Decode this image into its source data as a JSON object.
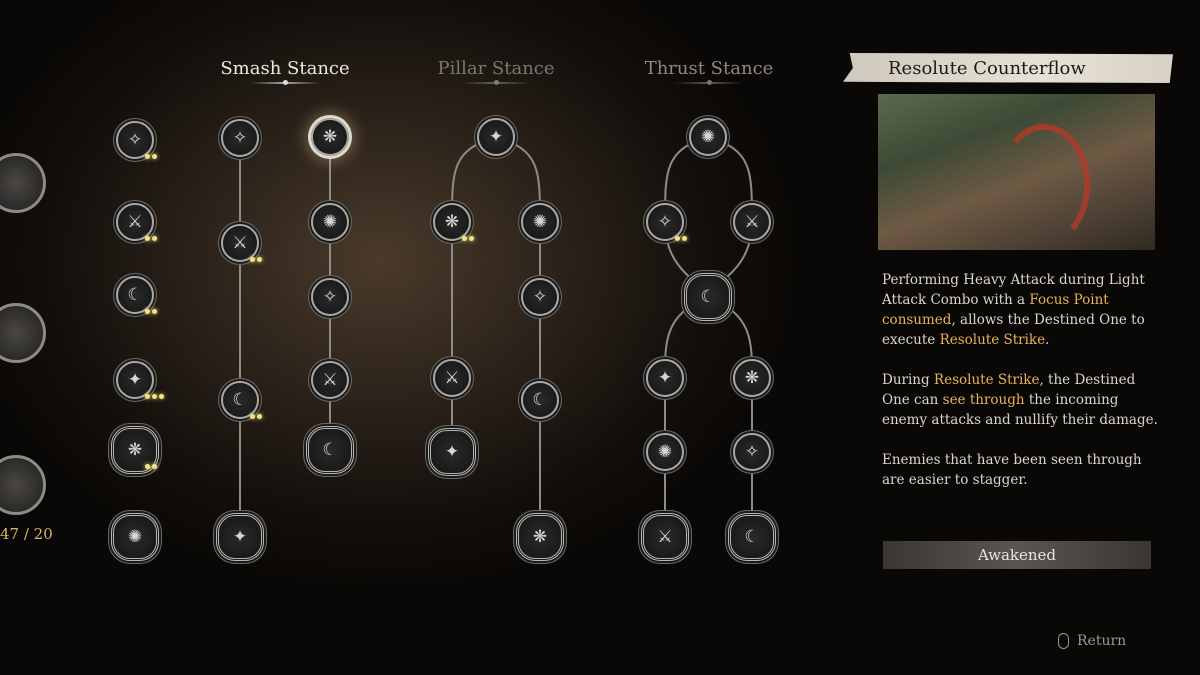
{
  "tabs": [
    {
      "label": "Smash Stance",
      "active": true
    },
    {
      "label": "Pillar Stance",
      "active": false
    },
    {
      "label": "Thrust Stance",
      "active": false
    }
  ],
  "points": {
    "text": "47 / 20"
  },
  "skill": {
    "title": "Resolute Counterflow",
    "paragraphs": [
      [
        {
          "t": "Performing Heavy Attack during Light Attack Combo with a "
        },
        {
          "t": "Focus Point consumed",
          "hl": true
        },
        {
          "t": ", allows the Destined One to execute "
        },
        {
          "t": "Resolute Strike",
          "hl": true
        },
        {
          "t": "."
        }
      ],
      [
        {
          "t": "During "
        },
        {
          "t": "Resolute Strike",
          "hl": true
        },
        {
          "t": ", the Destined One can "
        },
        {
          "t": "see through",
          "hl": true
        },
        {
          "t": " the incoming enemy attacks and nullify their damage."
        }
      ],
      [
        {
          "t": "Enemies that have been seen through are easier to stagger."
        }
      ]
    ],
    "status": "Awakened"
  },
  "footer": {
    "return_label": "Return",
    "return_icon": "mouse-icon"
  },
  "colors": {
    "highlight": "#e6b25c",
    "pip": "#f3e28a"
  },
  "nodes": [
    {
      "points": 2
    },
    {
      "points": 2
    },
    {
      "points": 2
    },
    {
      "points": 3
    },
    {
      "points": 2
    },
    {
      "points": 0
    },
    {
      "points": 0
    },
    {
      "points": 2
    },
    {
      "points": 2
    },
    {
      "points": 0
    },
    {
      "points": 0,
      "selected": true
    },
    {
      "points": 0
    },
    {
      "points": 0
    },
    {
      "points": 0
    },
    {
      "points": 0
    },
    {
      "points": 0
    },
    {
      "points": 2
    },
    {
      "points": 0
    },
    {
      "points": 0
    },
    {
      "points": 0
    },
    {
      "points": 0
    },
    {
      "points": 0
    },
    {
      "points": 0
    },
    {
      "points": 0
    },
    {
      "points": 2
    },
    {
      "points": 0
    },
    {
      "points": 0
    },
    {
      "points": 0
    },
    {
      "points": 0
    },
    {
      "points": 0
    },
    {
      "points": 0
    },
    {
      "points": 0
    },
    {
      "points": 0
    }
  ]
}
